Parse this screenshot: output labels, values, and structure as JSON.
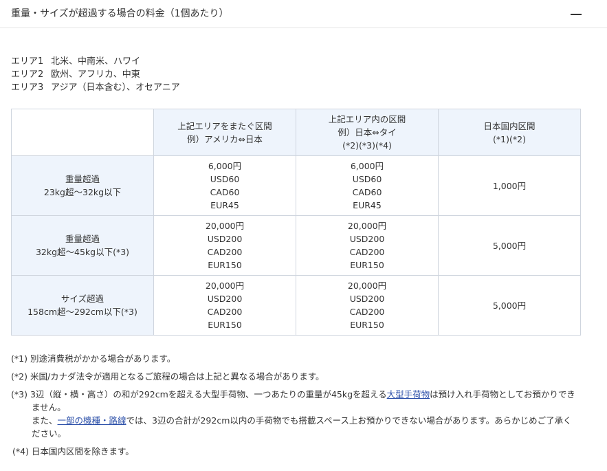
{
  "header": {
    "title": "重量・サイズが超過する場合の料金（1個あたり）"
  },
  "areas": [
    {
      "name": "エリア1",
      "regions": "北米、中南米、ハワイ"
    },
    {
      "name": "エリア2",
      "regions": "欧州、アフリカ、中東"
    },
    {
      "name": "エリア3",
      "regions": "アジア（日本含む）、オセアニア"
    }
  ],
  "table": {
    "columns": [
      {
        "lines": [
          "上記エリアをまたぐ区間",
          "例）アメリカ⇔日本"
        ]
      },
      {
        "lines": [
          "上記エリア内の区間",
          "例）日本⇔タイ",
          "(*2)(*3)(*4)"
        ]
      },
      {
        "lines": [
          "日本国内区間",
          "(*1)(*2)"
        ]
      }
    ],
    "rows": [
      {
        "label": [
          "重量超過",
          "23kg超～32kg以下"
        ],
        "cells": [
          [
            "6,000円",
            "USD60",
            "CAD60",
            "EUR45"
          ],
          [
            "6,000円",
            "USD60",
            "CAD60",
            "EUR45"
          ],
          [
            "1,000円"
          ]
        ]
      },
      {
        "label": [
          "重量超過",
          "32kg超～45kg以下(*3)"
        ],
        "cells": [
          [
            "20,000円",
            "USD200",
            "CAD200",
            "EUR150"
          ],
          [
            "20,000円",
            "USD200",
            "CAD200",
            "EUR150"
          ],
          [
            "5,000円"
          ]
        ]
      },
      {
        "label": [
          "サイズ超過",
          "158cm超～292cm以下(*3)"
        ],
        "cells": [
          [
            "20,000円",
            "USD200",
            "CAD200",
            "EUR150"
          ],
          [
            "20,000円",
            "USD200",
            "CAD200",
            "EUR150"
          ],
          [
            "5,000円"
          ]
        ]
      }
    ]
  },
  "notes": {
    "n1": {
      "mark": "(*1)",
      "text": "別途消費税がかかる場合があります。"
    },
    "n2": {
      "mark": "(*2)",
      "text": "米国/カナダ法令が適用となるご旅程の場合は上記と異なる場合があります。"
    },
    "n3": {
      "mark": "(*3)",
      "text_before": "3辺（縦・横・高さ）の和が292cmを超える大型手荷物、一つあたりの重量が45kgを超える",
      "link1": "大型手荷物",
      "text_after": "は預け入れ手荷物としてお預かりできません。",
      "line2_before": "また、",
      "link2": "一部の機種・路線",
      "line2_after": "では、3辺の合計が292cm以内の手荷物でも搭載スペース上お預かりできない場合があります。あらかじめご了承ください。"
    },
    "n4": {
      "mark": "(*4)",
      "text": "日本国内区間を除きます。"
    }
  }
}
